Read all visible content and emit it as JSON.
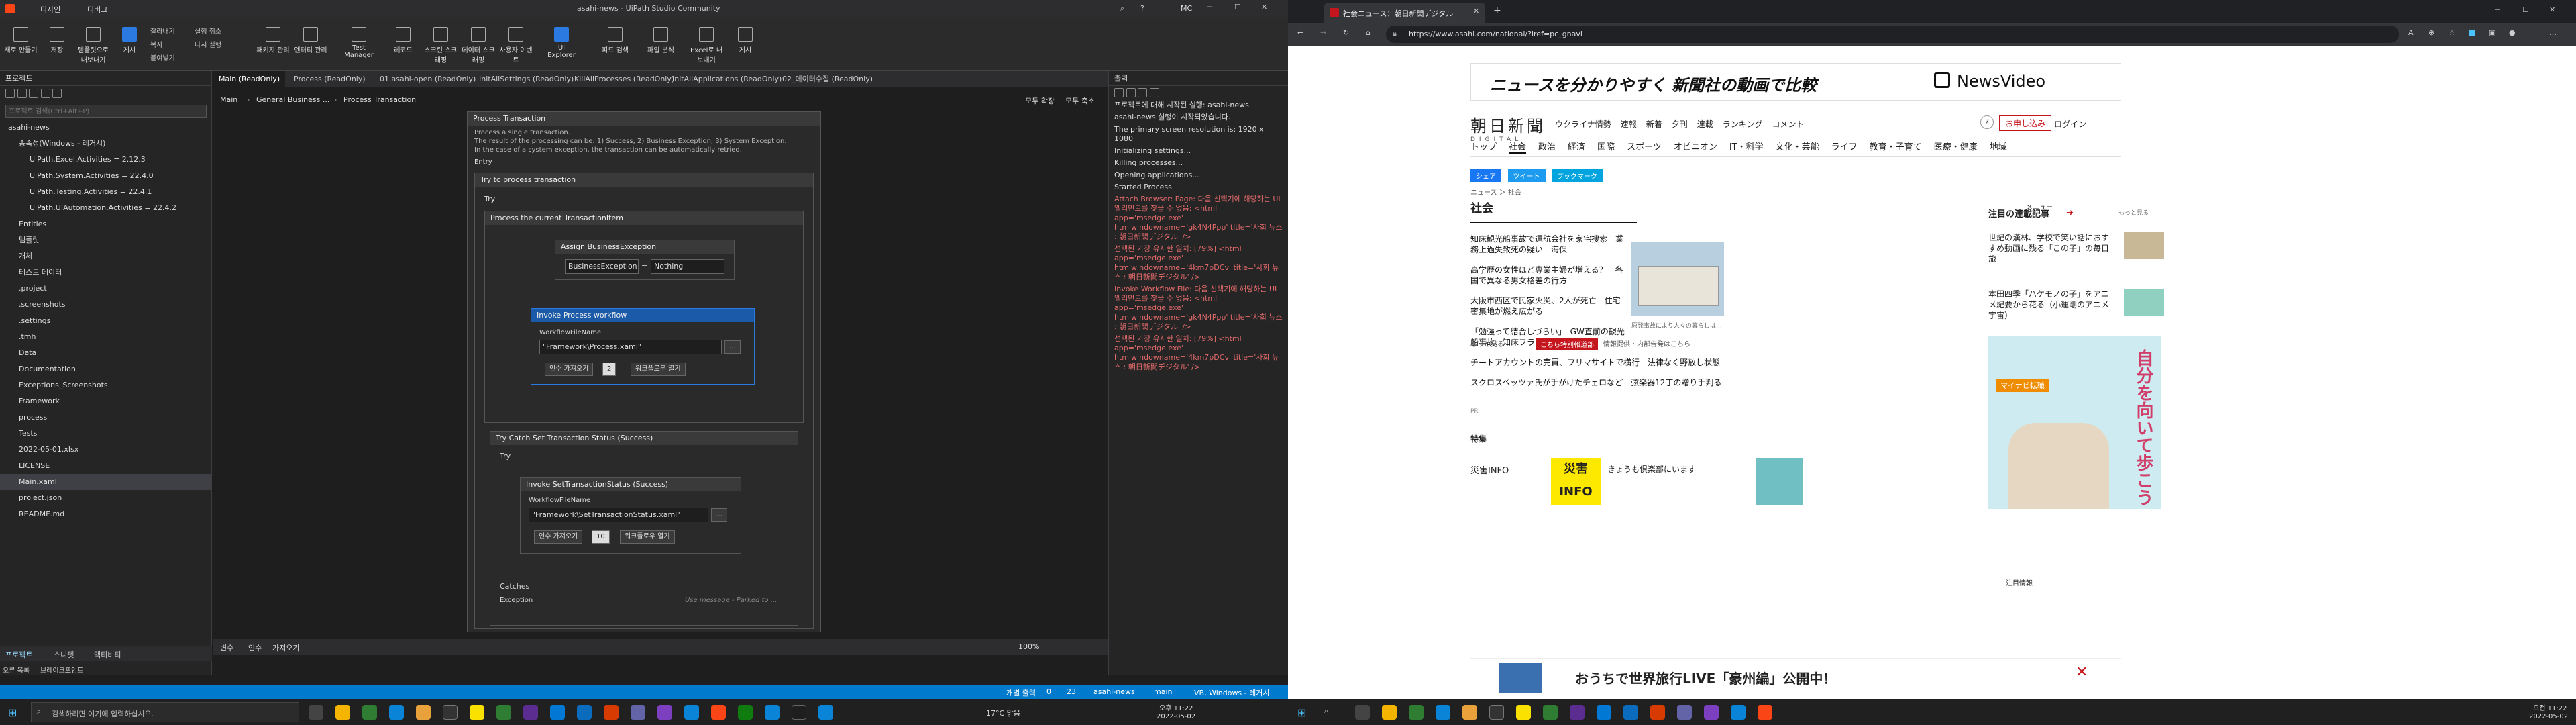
{
  "studio": {
    "title": "asahi-news - UiPath Studio Community",
    "tabs": [
      "디자인",
      "디버그"
    ],
    "user": "MC",
    "ribbon": [
      "새로 만들기",
      "저장",
      "템플릿으로 내보내기",
      "게시",
      "잘라내기",
      "복사",
      "붙여넣기",
      "실행 취소",
      "다시 실행",
      "패키지 관리",
      "엔터티 관리",
      "레코드",
      "스크린 스크래핑",
      "데이터 스크래핑",
      "사용자 이벤트",
      "Test Manager",
      "UI Explorer",
      "피드 검색",
      "파일 분석",
      "Excel로 내보내기",
      "게시"
    ],
    "project_title": "프로젝트",
    "search_placeholder": "프로젝트 검색(Ctrl+Alt+P)",
    "tree": [
      "asahi-news",
      "종속성(Windows - 레거시)",
      "UiPath.Excel.Activities = 2.12.3",
      "UiPath.System.Activities = 22.4.0",
      "UiPath.Testing.Activities = 22.4.1",
      "UiPath.UIAutomation.Activities = 22.4.2",
      "Entities",
      "템플릿",
      "개체",
      "테스트 데이터",
      ".project",
      ".screenshots",
      ".settings",
      ".tmh",
      "Data",
      "Documentation",
      "Exceptions_Screenshots",
      "Framework",
      "process",
      "Tests",
      "2022-05-01.xlsx",
      "LICENSE",
      "Main.xaml",
      "project.json",
      "README.md"
    ],
    "doc_tabs": [
      "Main (ReadOnly)",
      "Process (ReadOnly)",
      "01.asahi-open (ReadOnly)",
      "InitAllSettings (ReadOnly)",
      "KillAllProcesses (ReadOnly)",
      "InitAllApplications (ReadOnly)",
      "02_데이터수집 (ReadOnly)"
    ],
    "breadcrumb": [
      "Main",
      "General Business ...",
      "Process Transaction"
    ],
    "bread_right": [
      "모두 확장",
      "모두 축소"
    ],
    "process_title": "Process Transaction",
    "process_desc": "Process a single transaction.",
    "process_desc2": "The result of the processing can be: 1) Success, 2) Business Exception, 3) System Exception.",
    "process_desc3": "In the case of a system exception, the transaction can be automatically retried.",
    "entry": "Entry",
    "try_process": "Try to process transaction",
    "try": "Try",
    "process_current": "Process the current TransactionItem",
    "assign": "Assign BusinessException",
    "assign_left": "BusinessException",
    "assign_right": "Nothing",
    "invoke_process": "Invoke Process workflow",
    "workflow_file": "WorkflowFileName",
    "process_path": "\"Framework\\Process.xaml\"",
    "import_args": "인수 가져오기",
    "arg_count1": "2",
    "open_wf": "워크플로우 열기",
    "try_catch": "Try Catch Set Transaction Status (Success)",
    "invoke_set": "Invoke SetTransactionStatus (Success)",
    "set_path": "\"Framework\\SetTransactionStatus.xaml\"",
    "arg_count2": "10",
    "catches": "Catches",
    "exception": "Exception",
    "catch_note": "Use message - Parked to ...",
    "zoom": "100%",
    "bottom_tabs": [
      "변수",
      "인수",
      "가져오기"
    ],
    "output_title": "출력",
    "output": [
      {
        "t": "프로젝트에 대해 시작된 실행: asahi-news",
        "e": false
      },
      {
        "t": "asahi-news 실행이 시작되었습니다.",
        "e": false
      },
      {
        "t": "The primary screen resolution is: 1920 x 1080",
        "e": false
      },
      {
        "t": "Initializing settings...",
        "e": false
      },
      {
        "t": "Killing processes...",
        "e": false
      },
      {
        "t": "Opening applications...",
        "e": false
      },
      {
        "t": "Started Process",
        "e": false
      },
      {
        "t": "Attach Browser: Page: 다음 선택기에 해당하는 UI 엘리먼트를 찾을 수 없음: <html app='msedge.exe' htmlwindowname='gk4N4Ppp' title='사회 뉴스 : 朝日新聞デジタル' />",
        "e": true
      },
      {
        "t": "선택된 가장 유사한 일치: [79%] <html app='msedge.exe' htmlwindowname='4km7pDCv' title='사회 뉴스 : 朝日新聞デジタル' />",
        "e": true
      },
      {
        "t": "Invoke Workflow File: 다음 선택기에 해당하는 UI 엘리먼트를 찾을 수 없음: <html app='msedge.exe' htmlwindowname='gk4N4Ppp' title='사회 뉴스 : 朝日新聞デジタル' />",
        "e": true
      },
      {
        "t": "선택된 가장 유사한 일치: [79%] <html app='msedge.exe' htmlwindowname='4km7pDCv' title='사회 뉴스 : 朝日新聞デジタル' />",
        "e": true
      }
    ],
    "left_bottom_tabs": [
      "프로젝트",
      "스니펫",
      "액티비티"
    ],
    "panel_tabs": [
      "오류 목록",
      "브레이크포인트"
    ],
    "status": [
      "개별 출력",
      "0",
      "23",
      "asahi-news",
      "main",
      "VB, Windows - 레거시"
    ]
  },
  "taskbar_left": {
    "search": "검색하려면 여기에 입력하십시오.",
    "weather": "17°C 맑음",
    "time": "오후 11:22",
    "date": "2022-05-02"
  },
  "browser": {
    "tab_title": "社会ニュース：朝日新聞デジタル",
    "url": "https://www.asahi.com/national/?iref=pc_gnavi",
    "banner": "ニュースを分かりやすく 新聞社の動画で比較",
    "newsvideo": "NewsVideo",
    "logo": "朝日新聞",
    "logo_sub": "DIGITAL",
    "top_links": [
      "ウクライナ情勢",
      "速報",
      "新着",
      "夕刊",
      "連載",
      "ランキング",
      "コメント"
    ],
    "signup": "お申し込み",
    "login": "ログイン",
    "nav": [
      "トップ",
      "社会",
      "政治",
      "経済",
      "国際",
      "スポーツ",
      "オピニオン",
      "IT・科学",
      "文化・芸能",
      "ライフ",
      "教育・子育て",
      "医療・健康",
      "地域"
    ],
    "share": [
      "シェア",
      "ツイート",
      "ブックマーク"
    ],
    "crumbs": "ニュース ＞ 社会",
    "section": "社会",
    "menu": "メニュー",
    "news": [
      "知床観光船事故で運航会社を家宅捜索　業務上過失致死の疑い　海保",
      "高学歴の女性ほど専業主婦が増える？　各国で異なる男女格差の行方",
      "大阪市西区で民家火災、2人が死亡　住宅密集地が燃え広がる",
      "「勉強って結合しづらい」　GW直前の観光船事故、知床フランド打撃",
      "チートアカウントの売買、フリマサイトで横行　法律なく野放し状態",
      "スクロスベッツァ氏が手がけたチェロなど　弦楽器12丁の贈り手判る"
    ],
    "more": "もっと見る",
    "red_badge": "こちら特別報道部",
    "red_note": "情報提供・内部告発はこちら",
    "photo_caption": "原発事故により人々の暮らしは…",
    "pr": "PR",
    "special": "特集",
    "special_items": [
      "災害INFO",
      "きょうも倶楽部にいます"
    ],
    "right_title": "注目の連載記事",
    "right_more": "もっと見る",
    "right_items": [
      "世紀の漢林、学校で笑い話におすすめ動画に残る「この子」の毎日旅",
      "本田四季「ハケモノの子」をアニメ紀要から花る（小運剛のアニメ宇宙）"
    ],
    "ad_text": "自分を向いて歩こう",
    "ad_brand": "マイナビ転職",
    "notice": "注目情報",
    "bottom_ad": "おうちで世界旅行LIVE「豪州編」公開中！"
  },
  "taskbar_right": {
    "time": "오전 11:22",
    "date": "2022-05-02"
  }
}
